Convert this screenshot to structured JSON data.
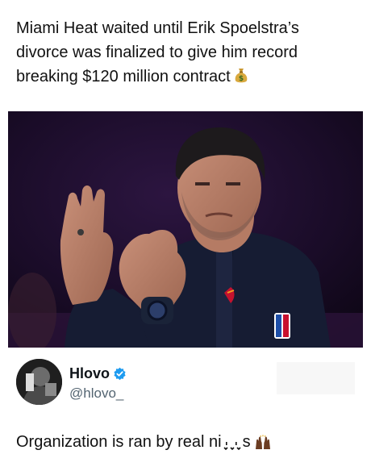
{
  "post": {
    "headline": "Miami Heat waited until Erik Spoelstra’s divorce was finalized to give him record breaking $120 million contract",
    "headline_emoji": "money-bag-icon"
  },
  "quote": {
    "display_name": "Hlovo",
    "handle": "@hlovo_",
    "text": "Organization is ran by real ni",
    "text_tail": "s",
    "text_emoji": "raised-hands-icon"
  },
  "colors": {
    "verified": "#1d9bf0",
    "jacket": "#161c33",
    "background": "#160a22"
  }
}
